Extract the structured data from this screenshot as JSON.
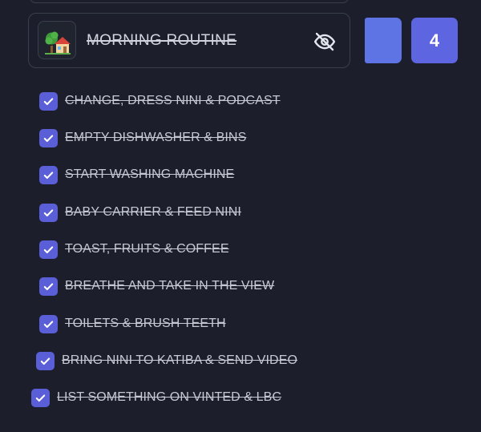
{
  "routine": {
    "title": "MORNING ROUTINE",
    "avatar_icon": "house-with-tree-icon",
    "visibility_icon": "eye-off-icon",
    "count": "4"
  },
  "colors": {
    "background": "#1c1f2b",
    "accent": "#5d65e0",
    "checkbox": "#5a5fd8",
    "text": "#c5c9d3"
  },
  "tasks": [
    {
      "label": "CHANGE, DRESS NINI & PODCAST",
      "done": true
    },
    {
      "label": "EMPTY DISHWASHER & BINS",
      "done": true
    },
    {
      "label": "START WASHING MACHINE",
      "done": true
    },
    {
      "label": "BABY CARRIER & FEED NINI",
      "done": true
    },
    {
      "label": "TOAST, FRUITS & COFFEE",
      "done": true
    },
    {
      "label": "BREATHE AND TAKE IN THE VIEW",
      "done": true
    },
    {
      "label": "TOILETS & BRUSH TEETH",
      "done": true
    },
    {
      "label": "BRING NINI TO KATIBA & SEND VIDEO",
      "done": true
    },
    {
      "label": "LIST SOMETHING ON VINTED & LBC",
      "done": true
    }
  ]
}
